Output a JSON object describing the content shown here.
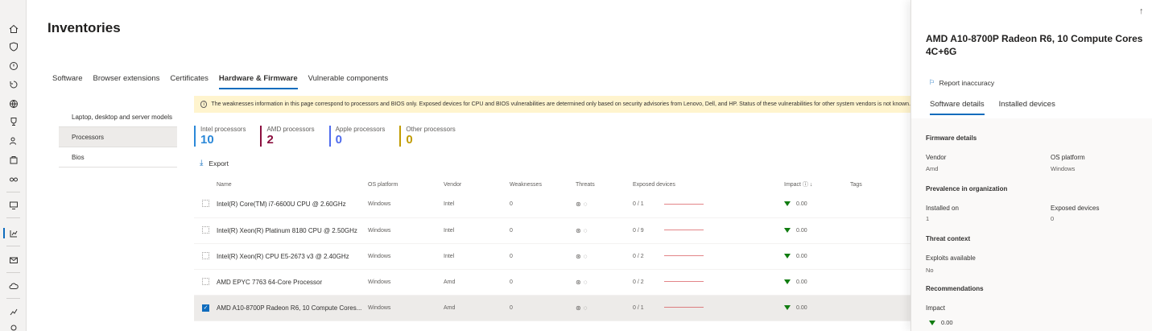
{
  "page": {
    "title": "Inventories"
  },
  "tabs": [
    "Software",
    "Browser extensions",
    "Certificates",
    "Hardware & Firmware",
    "Vulnerable components"
  ],
  "active_tab": "Hardware & Firmware",
  "subnav": [
    {
      "label": "Laptop, desktop and server models"
    },
    {
      "label": "Processors"
    },
    {
      "label": "Bios"
    }
  ],
  "banner": {
    "icon": "info-icon",
    "text": "The weaknesses information in this page correspond to processors and BIOS only. Exposed devices for CPU and BIOS vulnerabilities are determined only based on security advisories from Lenovo, Dell, and HP. Status of these vulnerabilities for other system vendors is not known."
  },
  "counts": [
    {
      "label": "Intel processors",
      "value": "10",
      "color": "#2b88d8"
    },
    {
      "label": "AMD processors",
      "value": "2",
      "color": "#8b0f3f"
    },
    {
      "label": "Apple processors",
      "value": "0",
      "color": "#4f6bed"
    },
    {
      "label": "Other processors",
      "value": "0",
      "color": "#c19c00"
    }
  ],
  "toolbar": {
    "export_label": "Export"
  },
  "table": {
    "headers": [
      "Name",
      "OS platform",
      "Vendor",
      "Weaknesses",
      "Threats",
      "Exposed devices",
      "Impact",
      "Tags"
    ],
    "rows": [
      {
        "name": "Intel(R) Core(TM) i7-6600U CPU @ 2.60GHz",
        "os": "Windows",
        "vendor": "Intel",
        "weaknesses": "0",
        "exposed": "0 / 1",
        "impact": "0.00"
      },
      {
        "name": "Intel(R) Xeon(R) Platinum 8180 CPU @ 2.50GHz",
        "os": "Windows",
        "vendor": "Intel",
        "weaknesses": "0",
        "exposed": "0 / 9",
        "impact": "0.00"
      },
      {
        "name": "Intel(R) Xeon(R) CPU E5-2673 v3 @ 2.40GHz",
        "os": "Windows",
        "vendor": "Intel",
        "weaknesses": "0",
        "exposed": "0 / 2",
        "impact": "0.00"
      },
      {
        "name": "AMD EPYC 7763 64-Core Processor",
        "os": "Windows",
        "vendor": "Amd",
        "weaknesses": "0",
        "exposed": "0 / 2",
        "impact": "0.00"
      },
      {
        "name": "AMD A10-8700P Radeon R6, 10 Compute Cores...",
        "os": "Windows",
        "vendor": "Amd",
        "weaknesses": "0",
        "exposed": "0 / 1",
        "impact": "0.00"
      }
    ],
    "selected_row": 4
  },
  "panel": {
    "title": "AMD A10-8700P Radeon R6, 10 Compute Cores 4C+6G",
    "report_label": "Report inaccuracy",
    "tabs": [
      "Software details",
      "Installed devices"
    ],
    "firmware_heading": "Firmware details",
    "vendor_label": "Vendor",
    "vendor_value": "Amd",
    "os_label": "OS platform",
    "os_value": "Windows",
    "prevalence_heading": "Prevalence in organization",
    "installed_label": "Installed on",
    "installed_value": "1",
    "exposed_label": "Exposed devices",
    "exposed_value": "0",
    "threat_heading": "Threat context",
    "exploits_label": "Exploits available",
    "exploits_value": "No",
    "recommendations_heading": "Recommendations",
    "impact_label": "Impact",
    "impact_value": "0.00"
  }
}
